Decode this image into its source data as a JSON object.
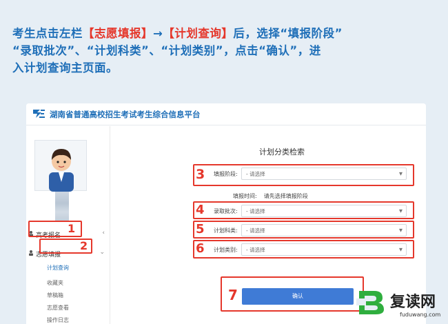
{
  "instruction": {
    "p1": "考生点击左栏",
    "menu1": "【志愿填报】",
    "arrow": "→",
    "menu2": "【计划查询】",
    "p2": "后，选择“填报阶段”",
    "p3": "“录取批次”、“计划科类”、“计划类别”，点击“确认”，进",
    "p4": "入计划查询主页面。"
  },
  "header": {
    "site_title": "湖南省普通高校招生考试考生综合信息平台"
  },
  "sidebar": {
    "items": [
      {
        "label": "高考报名",
        "chevron": "‹"
      },
      {
        "label": "志愿填报",
        "chevron": "⌄"
      }
    ],
    "subitems": [
      "计划查询",
      "收藏夹",
      "草稿箱",
      "志愿查看",
      "操作日志"
    ]
  },
  "form": {
    "title": "计划分类检索",
    "fields": [
      {
        "label": "填报阶段:",
        "value": "- 请选择"
      },
      {
        "label": "录取批次:",
        "value": "- 请选择"
      },
      {
        "label": "计划科类:",
        "value": "- 请选择"
      },
      {
        "label": "计划类别:",
        "value": "- 请选择"
      }
    ],
    "note_label": "填报时间:",
    "note_value": "请先选择填报阶段",
    "confirm_label": "确认"
  },
  "annotations": {
    "n1": "1",
    "n2": "2",
    "n3": "3",
    "n4": "4",
    "n5": "5",
    "n6": "6",
    "n7": "7"
  },
  "watermark": {
    "title": "复读网",
    "url": "fuduwang.com"
  },
  "colors": {
    "accent_blue": "#1f6fb8",
    "highlight_red": "#e5372b",
    "button_blue": "#3f7bd6"
  }
}
